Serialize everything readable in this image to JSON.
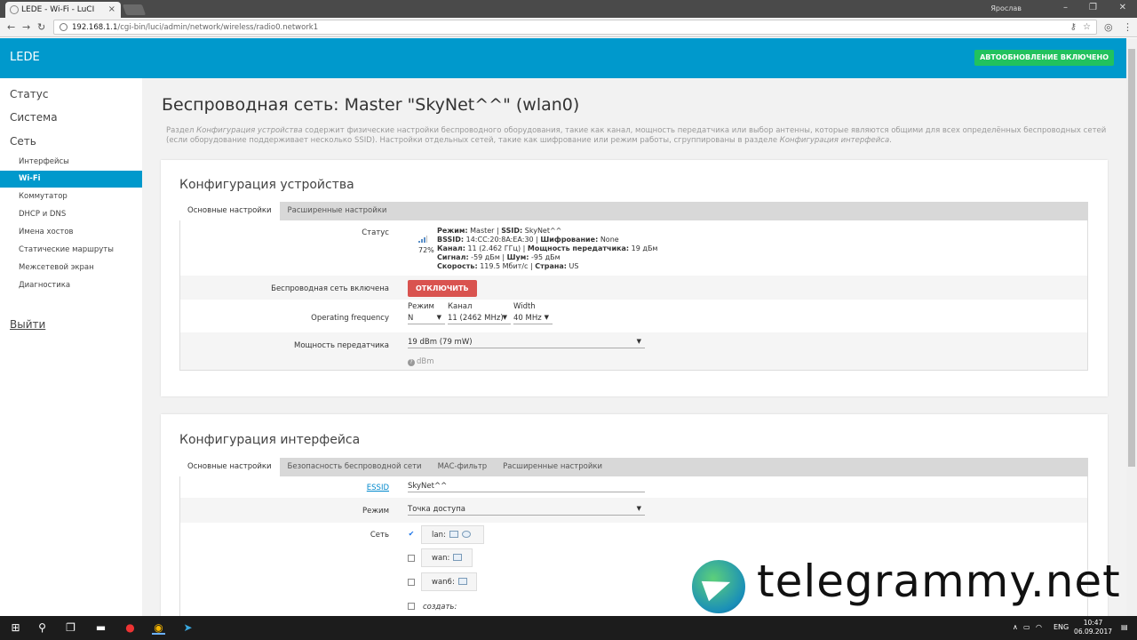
{
  "browser": {
    "tab_title": "LEDE - Wi-Fi - LuCI",
    "window_user": "Ярослав",
    "url_host": "192.168.1.1",
    "url_path": "/cgi-bin/luci/admin/network/wireless/radio0.network1"
  },
  "header": {
    "logo": "LEDE",
    "autorefresh": "АВТООБНОВЛЕНИЕ ВКЛЮЧЕНО",
    "accent_color": "#0099cc",
    "autorefresh_color": "#21c25e"
  },
  "sidebar": {
    "top_items": [
      "Статус",
      "Система",
      "Сеть"
    ],
    "sub_items": [
      "Интерфейсы",
      "Wi-Fi",
      "Коммутатор",
      "DHCP и DNS",
      "Имена хостов",
      "Статические маршруты",
      "Межсетевой экран",
      "Диагностика"
    ],
    "active": "Wi-Fi",
    "logout": "Выйти"
  },
  "page": {
    "title": "Беспроводная сеть: Master \"SkyNet^^\" (wlan0)",
    "desc_1": "Раздел ",
    "desc_em1": "Конфигурация устройства",
    "desc_2": " содержит физические настройки беспроводного оборудования, такие как канал, мощность передатчика или выбор антенны, которые являются общими для всех определённых беспроводных сетей (если оборудование поддерживает несколько SSID). Настройки отдельных сетей, такие как шифрование или режим работы, сгруппированы в разделе ",
    "desc_em2": "Конфигурация интерфейса",
    "desc_3": "."
  },
  "device_config": {
    "heading": "Конфигурация устройства",
    "tabs": [
      "Основные настройки",
      "Расширенные настройки"
    ],
    "status_label": "Статус",
    "signal_percent": "72%",
    "status": {
      "mode_k": "Режим:",
      "mode_v": " Master | ",
      "ssid_k": "SSID:",
      "ssid_v": " SkyNet^^",
      "bssid_k": "BSSID:",
      "bssid_v": " 14:CC:20:8A:EA:30 | ",
      "enc_k": "Шифрование:",
      "enc_v": " None",
      "chan_k": "Канал:",
      "chan_v": " 11 (2.462 ГГц) | ",
      "pow_k": "Мощность передатчика:",
      "pow_v": " 19 дБм",
      "sig_k": "Сигнал:",
      "sig_v": " -59 дБм | ",
      "noise_k": "Шум:",
      "noise_v": " -95 дБм",
      "rate_k": "Скорость:",
      "rate_v": " 119.5 Мбит/с | ",
      "country_k": "Страна:",
      "country_v": " US"
    },
    "enabled_label": "Беспроводная сеть включена",
    "disable_button": "ОТКЛЮЧИТЬ",
    "freq_label": "Operating frequency",
    "freq_mode_label": "Режим",
    "freq_mode_value": "N",
    "freq_channel_label": "Канал",
    "freq_channel_value": "11 (2462 MHz)",
    "freq_width_label": "Width",
    "freq_width_value": "40 MHz",
    "txpower_label": "Мощность передатчика",
    "txpower_value": "19 dBm (79 mW)",
    "txpower_hint": "dBm"
  },
  "iface_config": {
    "heading": "Конфигурация интерфейса",
    "tabs": [
      "Основные настройки",
      "Безопасность беспроводной сети",
      "MAC-фильтр",
      "Расширенные настройки"
    ],
    "essid_label": "ESSID",
    "essid_value": "SkyNet^^",
    "mode_label": "Режим",
    "mode_value": "Точка доступа",
    "network_label": "Сеть",
    "networks": [
      "lan:",
      "wan:",
      "wan6:"
    ],
    "create_label": "создать:"
  },
  "watermark": {
    "text": "telegrammy.net"
  },
  "taskbar": {
    "lang": "ENG",
    "time": "10:47",
    "date": "06.09.2017"
  }
}
